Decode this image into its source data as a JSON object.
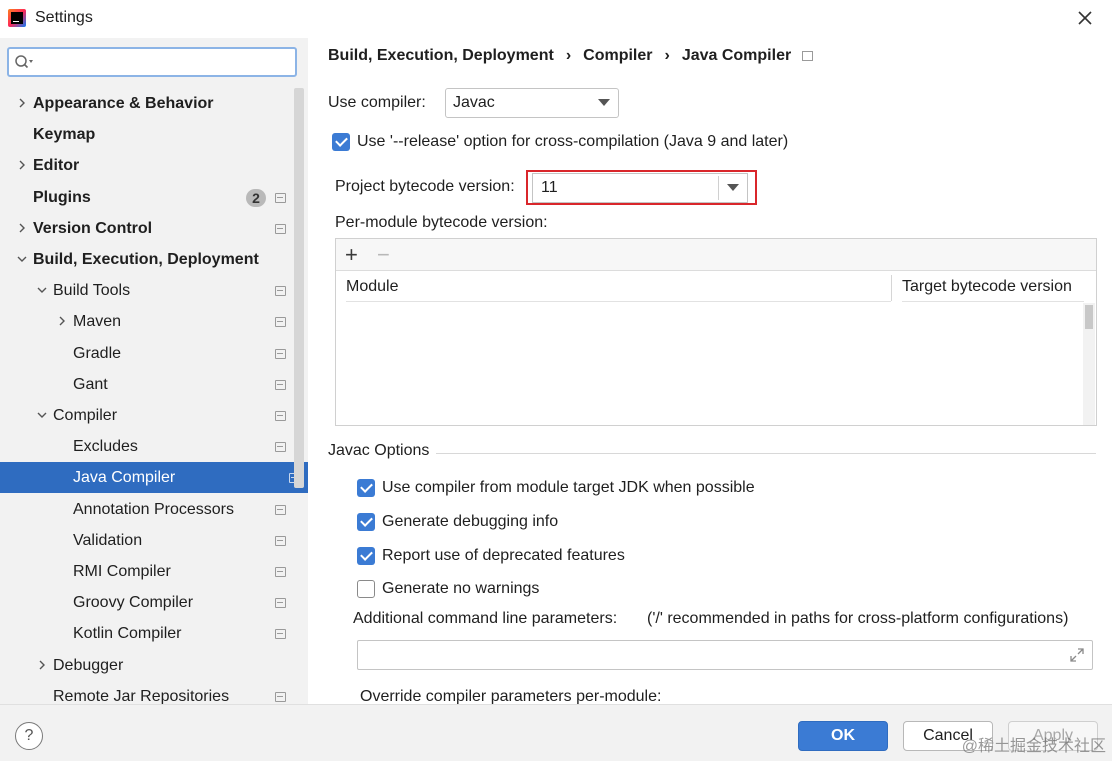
{
  "window": {
    "title": "Settings"
  },
  "sidebar": {
    "search": {
      "value": "",
      "placeholder": ""
    },
    "items": [
      {
        "label": "Appearance & Behavior",
        "bold": true,
        "depth": 0,
        "expander": "collapsed"
      },
      {
        "label": "Keymap",
        "bold": true,
        "depth": 0,
        "expander": "none"
      },
      {
        "label": "Editor",
        "bold": true,
        "depth": 0,
        "expander": "collapsed"
      },
      {
        "label": "Plugins",
        "bold": true,
        "depth": 0,
        "expander": "none",
        "badge": "2",
        "settings_icon": true
      },
      {
        "label": "Version Control",
        "bold": true,
        "depth": 0,
        "expander": "collapsed",
        "settings_icon": true
      },
      {
        "label": "Build, Execution, Deployment",
        "bold": true,
        "depth": 0,
        "expander": "expanded"
      },
      {
        "label": "Build Tools",
        "bold": false,
        "depth": 1,
        "expander": "expanded",
        "settings_icon": true
      },
      {
        "label": "Maven",
        "bold": false,
        "depth": 2,
        "expander": "collapsed",
        "settings_icon": true
      },
      {
        "label": "Gradle",
        "bold": false,
        "depth": 2,
        "expander": "none",
        "settings_icon": true
      },
      {
        "label": "Gant",
        "bold": false,
        "depth": 2,
        "expander": "none",
        "settings_icon": true
      },
      {
        "label": "Compiler",
        "bold": false,
        "depth": 1,
        "expander": "expanded",
        "settings_icon": true
      },
      {
        "label": "Excludes",
        "bold": false,
        "depth": 2,
        "expander": "none",
        "settings_icon": true
      },
      {
        "label": "Java Compiler",
        "bold": false,
        "depth": 2,
        "expander": "none",
        "settings_icon": true,
        "selected": true
      },
      {
        "label": "Annotation Processors",
        "bold": false,
        "depth": 2,
        "expander": "none",
        "settings_icon": true
      },
      {
        "label": "Validation",
        "bold": false,
        "depth": 2,
        "expander": "none",
        "settings_icon": true
      },
      {
        "label": "RMI Compiler",
        "bold": false,
        "depth": 2,
        "expander": "none",
        "settings_icon": true
      },
      {
        "label": "Groovy Compiler",
        "bold": false,
        "depth": 2,
        "expander": "none",
        "settings_icon": true
      },
      {
        "label": "Kotlin Compiler",
        "bold": false,
        "depth": 2,
        "expander": "none",
        "settings_icon": true
      },
      {
        "label": "Debugger",
        "bold": false,
        "depth": 1,
        "expander": "collapsed"
      },
      {
        "label": "Remote Jar Repositories",
        "bold": false,
        "depth": 1,
        "expander": "none",
        "settings_icon": true
      }
    ]
  },
  "breadcrumb": [
    "Build, Execution, Deployment",
    "Compiler",
    "Java Compiler"
  ],
  "breadcrumb_separator": "›",
  "main": {
    "use_compiler_label": "Use compiler:",
    "use_compiler_value": "Javac",
    "release_option": {
      "label": "Use '--release' option for cross-compilation (Java 9 and later)",
      "checked": true
    },
    "project_bytecode_label": "Project bytecode version:",
    "project_bytecode_value": "11",
    "per_module_label": "Per-module bytecode version:",
    "module_table": {
      "add_symbol": "+",
      "remove_symbol": "−",
      "columns": [
        "Module",
        "Target bytecode version"
      ],
      "rows": []
    },
    "javac_options_title": "Javac Options",
    "javac_options": [
      {
        "label": "Use compiler from module target JDK when possible",
        "checked": true
      },
      {
        "label": "Generate debugging info",
        "checked": true
      },
      {
        "label": "Report use of deprecated features",
        "checked": true
      },
      {
        "label": "Generate no warnings",
        "checked": false
      }
    ],
    "additional_params_label": "Additional command line parameters:",
    "additional_params_hint": "('/' recommended in paths for cross-platform configurations)",
    "additional_params_value": "",
    "override_label": "Override compiler parameters per-module:"
  },
  "footer": {
    "help_label": "?",
    "ok_label": "OK",
    "cancel_label": "Cancel",
    "apply_label": "Apply",
    "watermark": "@稀土掘金技术社区"
  },
  "colors": {
    "accent": "#3b7bd4",
    "selection": "#2f6cc0",
    "highlight_border": "#d9262b",
    "sidebar_bg": "#f2f2f2"
  }
}
